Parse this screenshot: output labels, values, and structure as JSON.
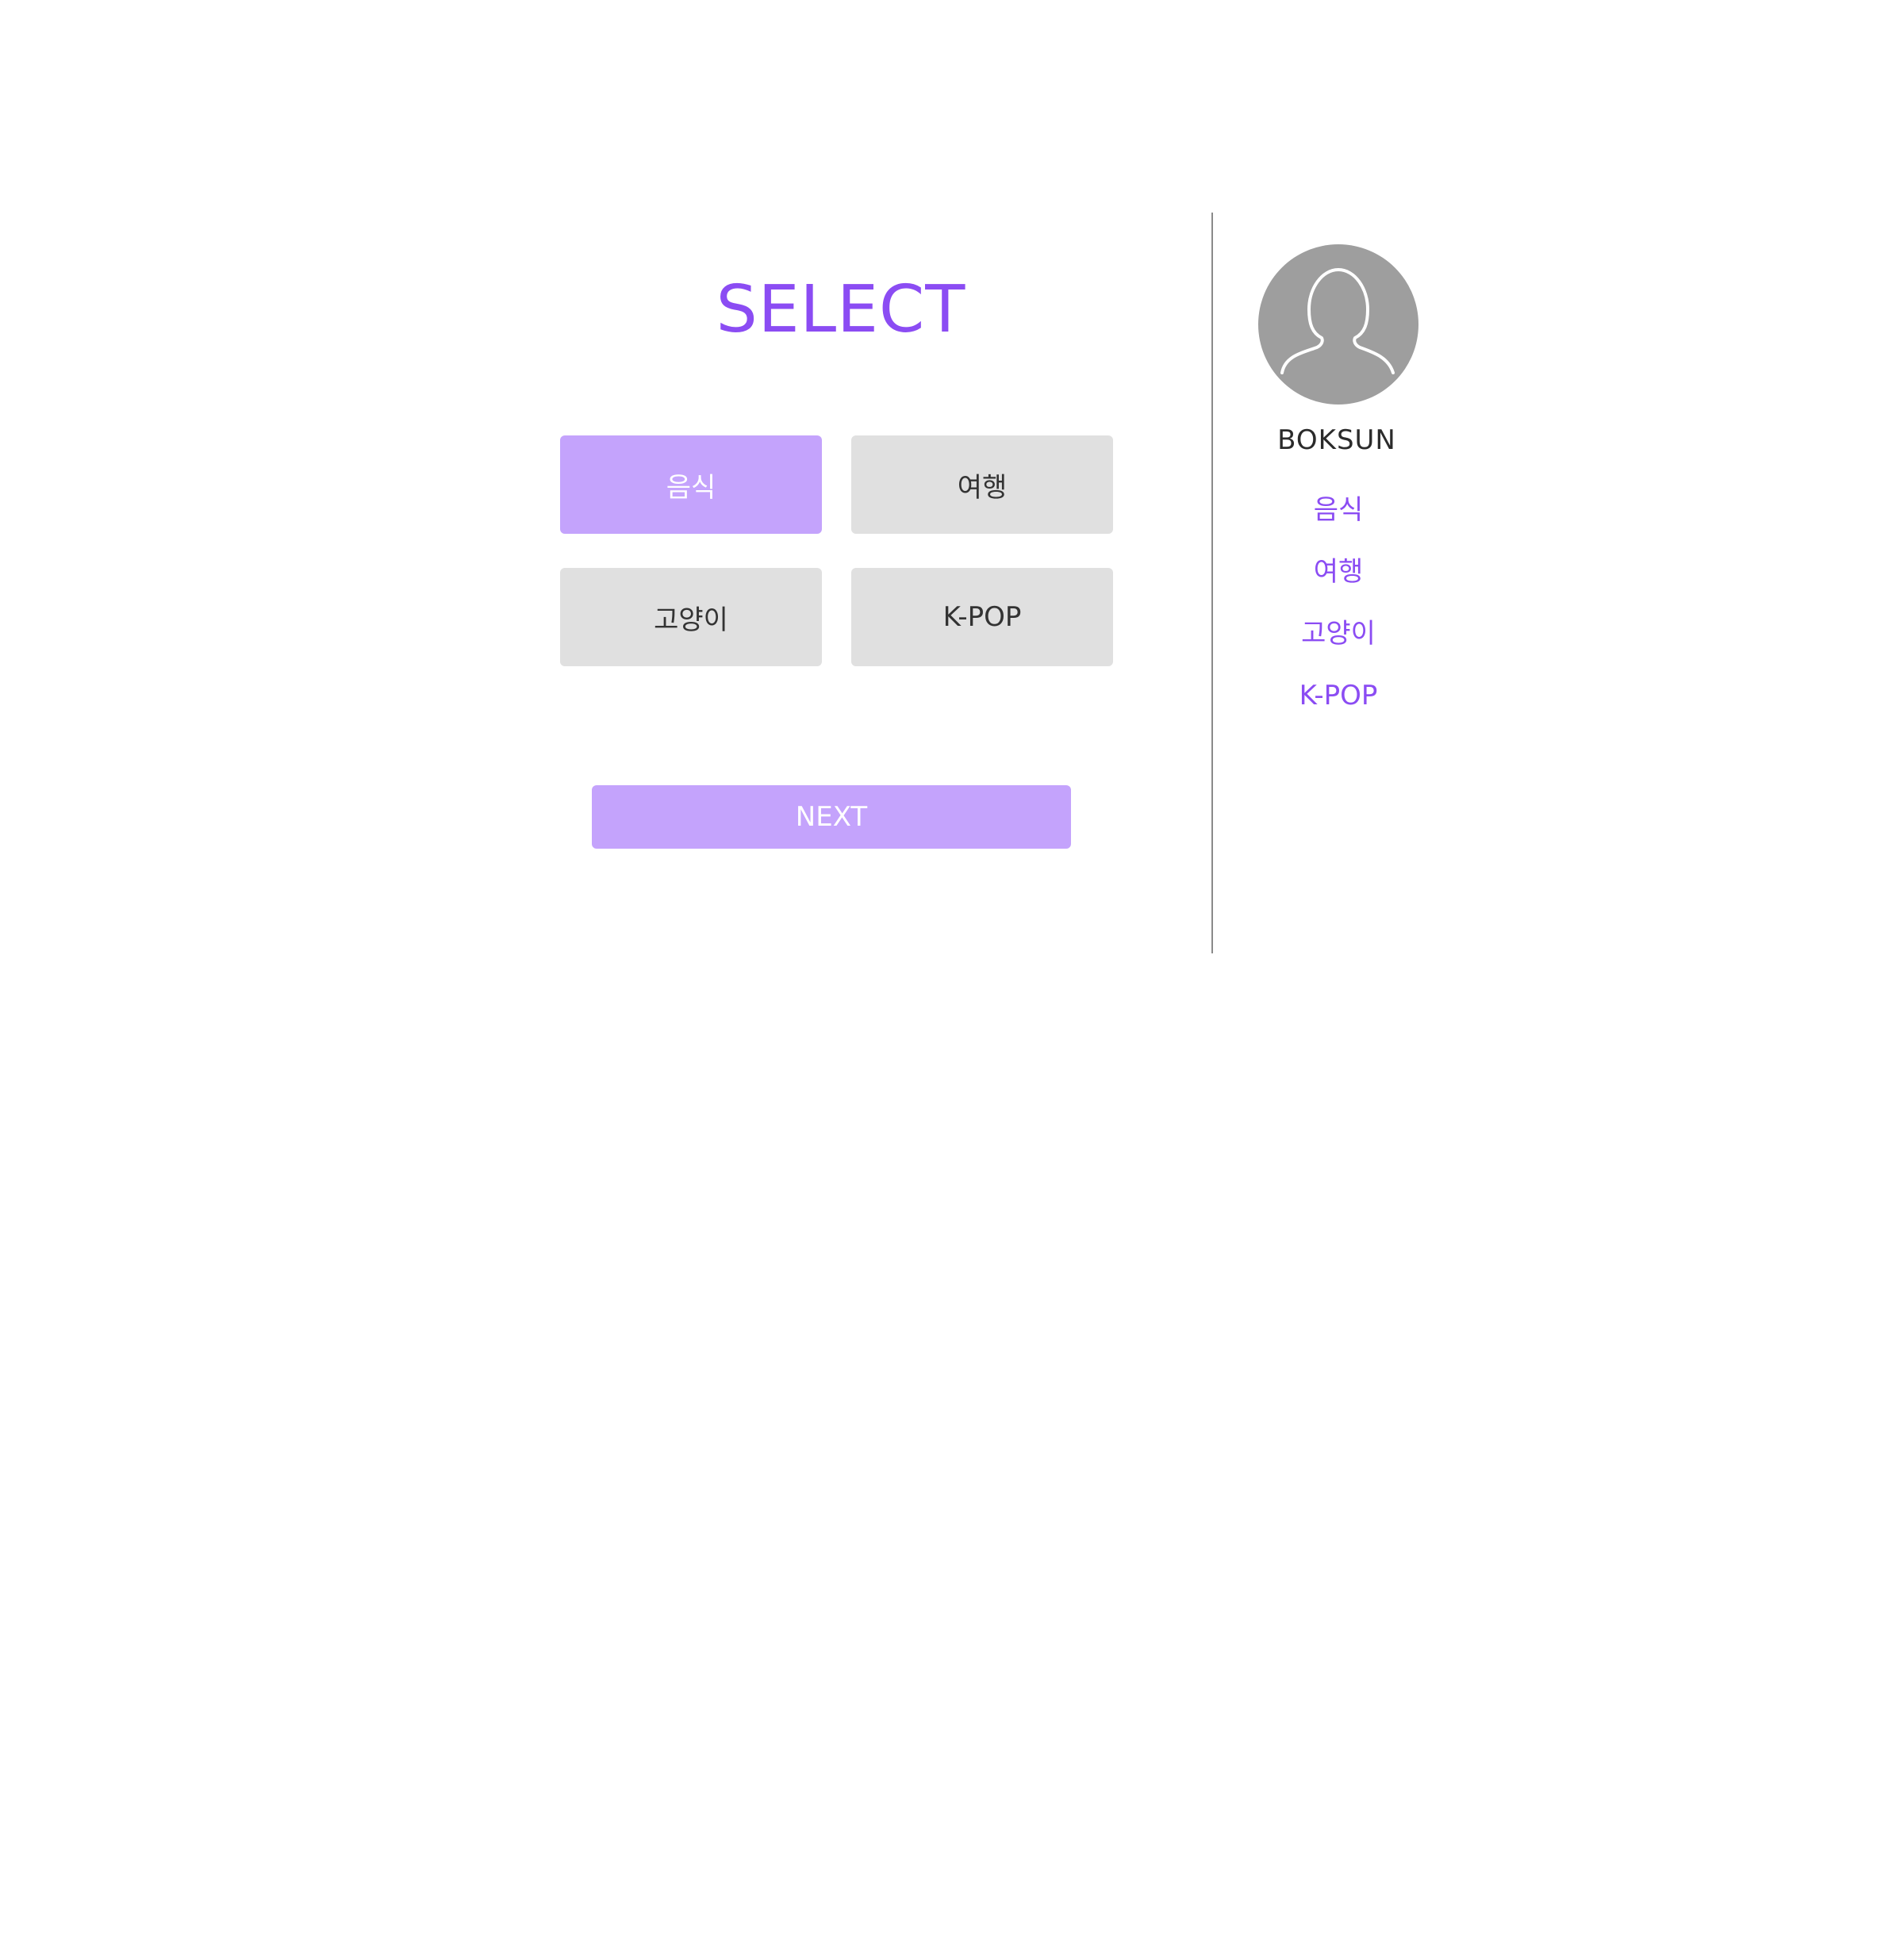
{
  "title": "SELECT",
  "categories": [
    {
      "label": "음식",
      "selected": true
    },
    {
      "label": "여행",
      "selected": false
    },
    {
      "label": "고양이",
      "selected": false
    },
    {
      "label": "K-POP",
      "selected": false
    }
  ],
  "next_label": "NEXT",
  "profile": {
    "avatar_icon": "person-silhouette-icon",
    "username": "BOKSUN",
    "selected_items": [
      "음식",
      "여행",
      "고양이",
      "K-POP"
    ]
  },
  "colors": {
    "accent": "#8b4cf3",
    "selected_bg": "#c4a3fc",
    "unselected_bg": "#e0e0e0",
    "avatar_bg": "#9e9e9e"
  }
}
